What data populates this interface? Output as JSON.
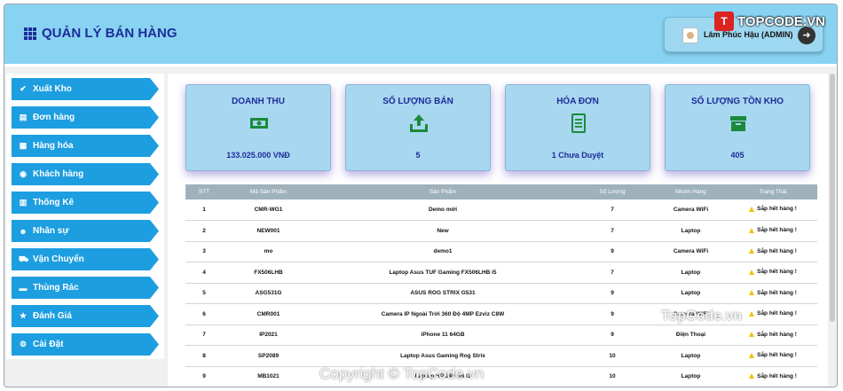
{
  "header": {
    "title": "QUẢN LÝ BÁN HÀNG",
    "user_name": "Lâm Phúc Hậu (ADMIN)"
  },
  "sidebar": {
    "items": [
      {
        "label": "Xuất Kho",
        "icon": "check-icon"
      },
      {
        "label": "Đơn hàng",
        "icon": "document-icon"
      },
      {
        "label": "Hàng hóa",
        "icon": "box-icon"
      },
      {
        "label": "Khách hàng",
        "icon": "user-circle-icon"
      },
      {
        "label": "Thống Kê",
        "icon": "bar-chart-icon"
      },
      {
        "label": "Nhân sự",
        "icon": "users-icon"
      },
      {
        "label": "Vận Chuyển",
        "icon": "truck-icon"
      },
      {
        "label": "Thùng Rác",
        "icon": "trash-icon"
      },
      {
        "label": "Đánh Giá",
        "icon": "star-icon"
      },
      {
        "label": "Cài Đặt",
        "icon": "gear-icon"
      }
    ]
  },
  "cards": [
    {
      "title": "DOANH THU",
      "value": "133.025.000 VNĐ",
      "icon": "money-icon"
    },
    {
      "title": "SỐ LƯỢNG BÁN",
      "value": "5",
      "icon": "upload-tray-icon"
    },
    {
      "title": "HÓA ĐƠN",
      "value": "1 Chưa Duyệt",
      "icon": "invoice-icon"
    },
    {
      "title": "SỐ LƯỢNG TỒN KHO",
      "value": "405",
      "icon": "inventory-box-icon"
    }
  ],
  "table": {
    "headers": [
      "STT",
      "Mã Sản Phẩm",
      "Sản Phẩm",
      "Số Lượng",
      "Nhóm Hàng",
      "Trạng Thái"
    ],
    "rows": [
      [
        "1",
        "CMR-WG1",
        "Demo mới",
        "7",
        "Camera WiFi",
        "Sắp hết hàng !"
      ],
      [
        "2",
        "NEW001",
        "New",
        "7",
        "Laptop",
        "Sắp hết hàng !"
      ],
      [
        "3",
        "mo",
        "demo1",
        "9",
        "Camera WiFi",
        "Sắp hết hàng !"
      ],
      [
        "4",
        "FX506LHB",
        "Laptop Asus TUF Gaming FX506LHB i5",
        "7",
        "Laptop",
        "Sắp hết hàng !"
      ],
      [
        "5",
        "ASG531G",
        "ASUS ROG STRIX G531",
        "9",
        "Laptop",
        "Sắp hết hàng !"
      ],
      [
        "6",
        "CMR001",
        "Camera IP Ngoài Trời 360 Độ 4MP Ezviz C8W",
        "9",
        "Camera WiFi",
        "Sắp hết hàng !"
      ],
      [
        "7",
        "IP2021",
        "iPhone 11 64GB",
        "9",
        "Điện Thoại",
        "Sắp hết hàng !"
      ],
      [
        "8",
        "SP2089",
        "Laptop Asus Gaming Rog Strix",
        "10",
        "Laptop",
        "Sắp hết hàng !"
      ],
      [
        "9",
        "MB1021",
        "Laptop HP 240 G8 i3",
        "10",
        "Laptop",
        "Sắp hết hàng !"
      ]
    ]
  },
  "watermarks": {
    "logo_mark": "T",
    "logo_text": "TOPCODE.VN",
    "mid": "TopCode.vn",
    "bottom": "Copyright © TopCode.vn"
  },
  "colors": {
    "header_bg": "#89d3f2",
    "nav_bg": "#1d9ee0",
    "accent_text": "#1d2d9a",
    "card_bg": "#a8d7f0",
    "icon_green": "#1b8a3a"
  }
}
